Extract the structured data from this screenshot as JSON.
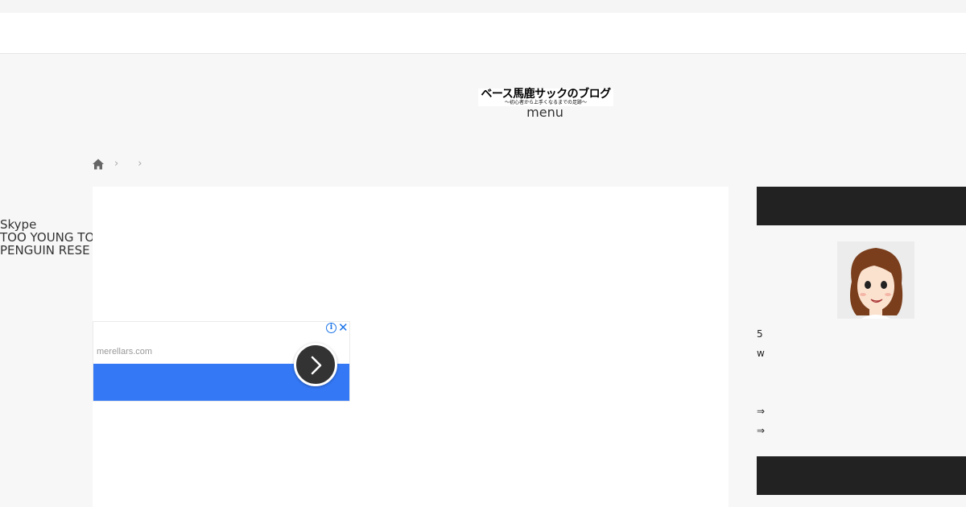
{
  "header": {
    "logo_title": "ベース馬鹿サックのブログ",
    "logo_subtitle": "〜初心者から上手くなるまでの足跡〜",
    "menu_label": "menu"
  },
  "sns": {
    "items": [
      "Skype",
      "TOO YOUNG TO",
      "PENGUIN RESE"
    ]
  },
  "ad": {
    "domain": "merellars.com",
    "info_glyph": "i",
    "close_glyph": "✕",
    "bar_color": "#3478f6"
  },
  "sidebar": {
    "line1": "5",
    "line2": "w",
    "link1": "⇒",
    "link2": "⇒",
    "header_color": "#222222"
  },
  "icons": {
    "home": "home-icon",
    "chevron": "chevron-right-icon",
    "next": "arrow-right-icon"
  }
}
